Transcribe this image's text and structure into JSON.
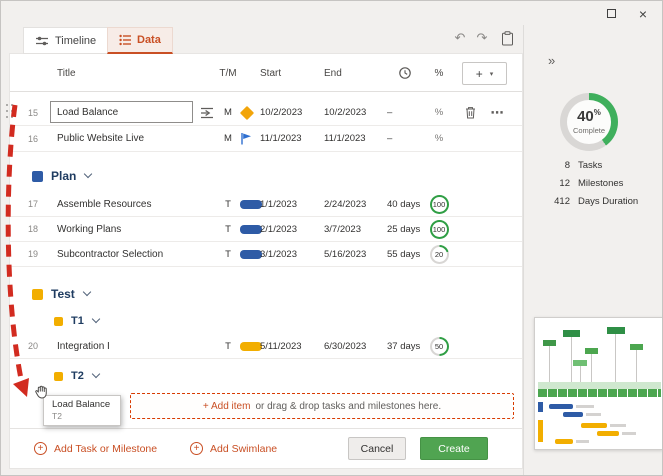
{
  "tabs": {
    "timeline": "Timeline",
    "data": "Data"
  },
  "icons": {
    "undo": "↶",
    "redo": "↷",
    "more": "⋯",
    "collapse": "»",
    "close": "×",
    "caret": "▾",
    "plus": "+"
  },
  "header": {
    "title": "Title",
    "tm": "T/M",
    "start": "Start",
    "end": "End",
    "percent": "%"
  },
  "rows": {
    "r15": {
      "num": "15",
      "title": "Load Balance",
      "tm": "M",
      "start": "10/2/2023",
      "end": "10/2/2023",
      "duration": "–",
      "percent": "%"
    },
    "r16": {
      "num": "16",
      "title": "Public Website Live",
      "tm": "M",
      "start": "11/1/2023",
      "end": "11/1/2023",
      "duration": "–",
      "percent": "%"
    },
    "r17": {
      "num": "17",
      "title": "Assemble Resources",
      "tm": "T",
      "start": "1/1/2023",
      "end": "2/24/2023",
      "duration": "40 days",
      "percent": "100"
    },
    "r18": {
      "num": "18",
      "title": "Working Plans",
      "tm": "T",
      "start": "2/1/2023",
      "end": "3/7/2023",
      "duration": "25 days",
      "percent": "100"
    },
    "r19": {
      "num": "19",
      "title": "Subcontractor Selection",
      "tm": "T",
      "start": "3/1/2023",
      "end": "5/16/2023",
      "duration": "55 days",
      "percent": "20"
    },
    "r20": {
      "num": "20",
      "title": "Integration I",
      "tm": "T",
      "start": "5/11/2023",
      "end": "6/30/2023",
      "duration": "37 days",
      "percent": "50"
    }
  },
  "lanes": {
    "plan": "Plan",
    "test": "Test",
    "t1": "T1",
    "t2": "T2"
  },
  "dropzone": {
    "add_label": "+ Add item",
    "hint": "or drag & drop tasks and milestones here."
  },
  "ghost": {
    "title": "Load Balance",
    "sublabel": "T2"
  },
  "footer": {
    "add_task": "Add Task or Milestone",
    "add_swimlane": "Add Swimlane",
    "cancel": "Cancel",
    "create": "Create"
  },
  "sidebar": {
    "progress": {
      "value": "40",
      "unit": "%",
      "label": "Complete"
    },
    "stats": [
      {
        "value": "8",
        "label": "Tasks"
      },
      {
        "value": "12",
        "label": "Milestones"
      },
      {
        "value": "412",
        "label": "Days Duration"
      }
    ]
  },
  "colors": {
    "accent_orange": "#C94F24",
    "dropzone_dash": "#D83B01",
    "arrow_red": "#D22B20",
    "task_blue": "#2E5BA6",
    "task_yellow": "#F2AE00",
    "milestone_diamond": "#F2A50A",
    "flag_blue": "#2E6FD0",
    "swimlane_navy": "#1F3C61",
    "badge_green": "#2F9E44",
    "create_green": "#50A451",
    "ring_green": "#3FAF5C"
  }
}
